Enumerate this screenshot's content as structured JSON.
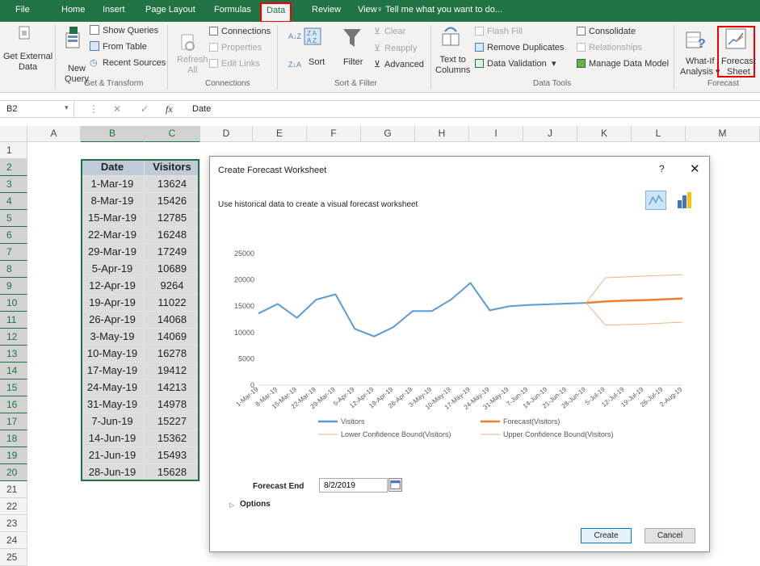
{
  "ribbon_tabs": [
    "File",
    "Home",
    "Insert",
    "Page Layout",
    "Formulas",
    "Data",
    "Review",
    "View"
  ],
  "active_tab": "Data",
  "tell_me": "Tell me what you want to do...",
  "ribbon": {
    "get_external": [
      "Get External",
      "Data"
    ],
    "new_query": [
      "New",
      "Query"
    ],
    "show_queries": "Show Queries",
    "from_table": "From Table",
    "recent_sources": "Recent Sources",
    "group_get_transform": "Get & Transform",
    "refresh": [
      "Refresh",
      "All"
    ],
    "connections": "Connections",
    "properties": "Properties",
    "edit_links": "Edit Links",
    "group_connections": "Connections",
    "sort": "Sort",
    "filter": "Filter",
    "clear": "Clear",
    "reapply": "Reapply",
    "advanced": "Advanced",
    "group_sort_filter": "Sort & Filter",
    "text_to_columns": [
      "Text to",
      "Columns"
    ],
    "flash_fill": "Flash Fill",
    "remove_duplicates": "Remove Duplicates",
    "data_validation": "Data Validation",
    "consolidate": "Consolidate",
    "relationships": "Relationships",
    "manage_data_model": "Manage Data Model",
    "group_data_tools": "Data Tools",
    "what_if": [
      "What-If",
      "Analysis"
    ],
    "forecast_sheet": [
      "Forecast",
      "Sheet"
    ],
    "group_forecast": "Forecast"
  },
  "formula_bar": {
    "name_box": "B2",
    "fx": "fx",
    "value": "Date"
  },
  "columns": [
    "A",
    "B",
    "C",
    "D",
    "E",
    "F",
    "G",
    "H",
    "I",
    "J",
    "K",
    "L",
    "M"
  ],
  "rows": [
    "1",
    "2",
    "3",
    "4",
    "5",
    "6",
    "7",
    "8",
    "9",
    "10",
    "11",
    "12",
    "13",
    "14",
    "15",
    "16",
    "17",
    "18",
    "19",
    "20",
    "21",
    "22",
    "23",
    "24",
    "25"
  ],
  "table": {
    "headers": [
      "Date",
      "Visitors"
    ],
    "rows": [
      [
        "1-Mar-19",
        "13624"
      ],
      [
        "8-Mar-19",
        "15426"
      ],
      [
        "15-Mar-19",
        "12785"
      ],
      [
        "22-Mar-19",
        "16248"
      ],
      [
        "29-Mar-19",
        "17249"
      ],
      [
        "5-Apr-19",
        "10689"
      ],
      [
        "12-Apr-19",
        "9264"
      ],
      [
        "19-Apr-19",
        "11022"
      ],
      [
        "26-Apr-19",
        "14068"
      ],
      [
        "3-May-19",
        "14069"
      ],
      [
        "10-May-19",
        "16278"
      ],
      [
        "17-May-19",
        "19412"
      ],
      [
        "24-May-19",
        "14213"
      ],
      [
        "31-May-19",
        "14978"
      ],
      [
        "7-Jun-19",
        "15227"
      ],
      [
        "14-Jun-19",
        "15362"
      ],
      [
        "21-Jun-19",
        "15493"
      ],
      [
        "28-Jun-19",
        "15628"
      ]
    ]
  },
  "dialog": {
    "title": "Create Forecast Worksheet",
    "help": "?",
    "close": "✕",
    "subtitle": "Use historical data to create a visual forecast worksheet",
    "forecast_end_label": "Forecast End",
    "forecast_end_value": "8/2/2019",
    "options_label": "Options",
    "create_label": "Create",
    "cancel_label": "Cancel"
  },
  "chart_data": {
    "type": "line",
    "x": [
      "1-Mar-19",
      "8-Mar-19",
      "15-Mar-19",
      "22-Mar-19",
      "29-Mar-19",
      "5-Apr-19",
      "12-Apr-19",
      "19-Apr-19",
      "26-Apr-19",
      "3-May-19",
      "10-May-19",
      "17-May-19",
      "24-May-19",
      "31-May-19",
      "7-Jun-19",
      "14-Jun-19",
      "21-Jun-19",
      "28-Jun-19",
      "5-Jul-19",
      "12-Jul-19",
      "19-Jul-19",
      "26-Jul-19",
      "2-Aug-19"
    ],
    "ylim": [
      0,
      25000
    ],
    "yticks": [
      0,
      5000,
      10000,
      15000,
      20000,
      25000
    ],
    "series": [
      {
        "name": "Visitors",
        "color": "#5b9bd5",
        "values": [
          13624,
          15426,
          12785,
          16248,
          17249,
          10689,
          9264,
          11022,
          14068,
          14069,
          16278,
          19412,
          14213,
          14978,
          15227,
          15362,
          15493,
          15628,
          null,
          null,
          null,
          null,
          null
        ]
      },
      {
        "name": "Forecast(Visitors)",
        "color": "#ed7d31",
        "values": [
          null,
          null,
          null,
          null,
          null,
          null,
          null,
          null,
          null,
          null,
          null,
          null,
          null,
          null,
          null,
          null,
          null,
          15628,
          15900,
          16050,
          16150,
          16300,
          16450
        ]
      },
      {
        "name": "Lower Confidence Bound(Visitors)",
        "color": "#f4b183",
        "values": [
          null,
          null,
          null,
          null,
          null,
          null,
          null,
          null,
          null,
          null,
          null,
          null,
          null,
          null,
          null,
          null,
          null,
          15628,
          11400,
          11500,
          11600,
          11800,
          11950
        ]
      },
      {
        "name": "Upper Confidence Bound(Visitors)",
        "color": "#f4b183",
        "values": [
          null,
          null,
          null,
          null,
          null,
          null,
          null,
          null,
          null,
          null,
          null,
          null,
          null,
          null,
          null,
          null,
          null,
          15628,
          20400,
          20550,
          20700,
          20850,
          21000
        ]
      }
    ],
    "legend": "bottom"
  }
}
